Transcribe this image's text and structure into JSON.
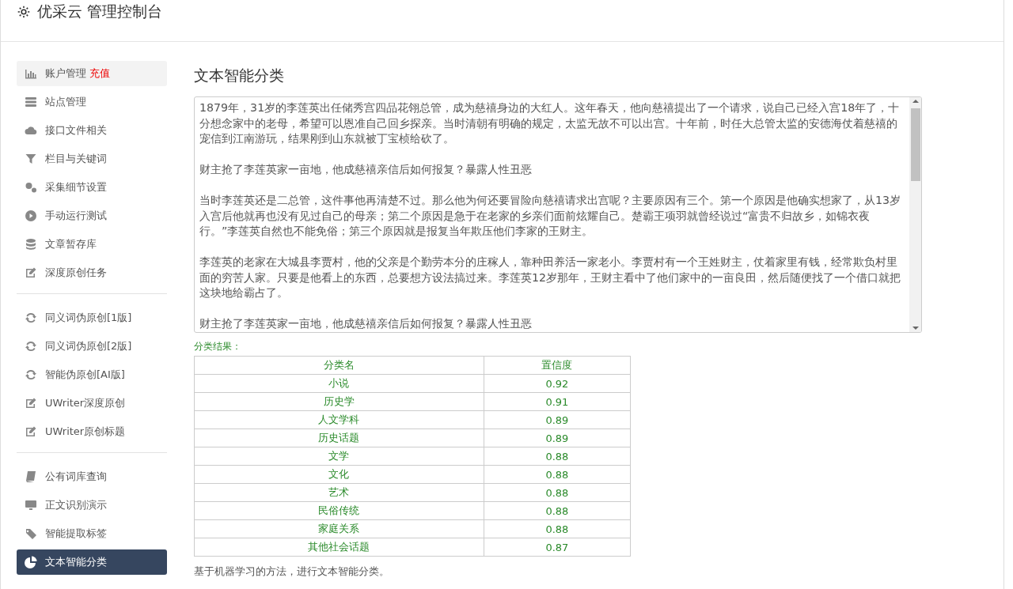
{
  "header": {
    "title": "优采云 管理控制台"
  },
  "sidebar": {
    "groups": [
      {
        "items": [
          {
            "label": "账户管理",
            "badge": "充值",
            "highlighted": true,
            "selected": false
          },
          {
            "label": "站点管理",
            "highlighted": false,
            "selected": false
          },
          {
            "label": "接口文件相关",
            "highlighted": false,
            "selected": false
          },
          {
            "label": "栏目与关键词",
            "highlighted": false,
            "selected": false
          },
          {
            "label": "采集细节设置",
            "highlighted": false,
            "selected": false
          },
          {
            "label": "手动运行测试",
            "highlighted": false,
            "selected": false
          },
          {
            "label": "文章暂存库",
            "highlighted": false,
            "selected": false
          },
          {
            "label": "深度原创任务",
            "highlighted": false,
            "selected": false
          }
        ]
      },
      {
        "items": [
          {
            "label": "同义词伪原创[1版]",
            "highlighted": false,
            "selected": false
          },
          {
            "label": "同义词伪原创[2版]",
            "highlighted": false,
            "selected": false
          },
          {
            "label": "智能伪原创[AI版]",
            "highlighted": false,
            "selected": false
          },
          {
            "label": "UWriter深度原创",
            "highlighted": false,
            "selected": false
          },
          {
            "label": "UWriter原创标题",
            "highlighted": false,
            "selected": false
          }
        ]
      },
      {
        "items": [
          {
            "label": "公有词库查询",
            "highlighted": false,
            "selected": false
          },
          {
            "label": "正文识别演示",
            "highlighted": false,
            "selected": false
          },
          {
            "label": "智能提取标签",
            "highlighted": false,
            "selected": false
          },
          {
            "label": "文本智能分类",
            "highlighted": false,
            "selected": true
          }
        ]
      }
    ]
  },
  "main": {
    "title": "文本智能分类",
    "text_input": {
      "paragraphs": [
        "1879年，31岁的李莲英出任储秀宫四品花翎总管，成为慈禧身边的大红人。这年春天，他向慈禧提出了一个请求，说自己已经入宫18年了，十分想念家中的老母，希望可以恩准自己回乡探亲。当时清朝有明确的规定，太监无故不可以出宫。十年前，时任大总管太监的安德海仗着慈禧的宠信到江南游玩，结果刚到山东就被丁宝桢给砍了。",
        "财主抢了李莲英家一亩地，他成慈禧亲信后如何报复？暴露人性丑恶",
        "当时李莲英还是二总管，这件事他再清楚不过。那么他为何还要冒险向慈禧请求出宫呢？主要原因有三个。第一个原因是他确实想家了，从13岁入宫后他就再也没有见过自己的母亲；第二个原因是急于在老家的乡亲们面前炫耀自己。楚霸王项羽就曾经说过“富贵不归故乡，如锦衣夜行。”李莲英自然也不能免俗；第三个原因就是报复当年欺压他们李家的王财主。",
        "李莲英的老家在大城县李贾村，他的父亲是个勤劳本分的庄稼人，靠种田养活一家老小。李贾村有一个王姓财主，仗着家里有钱，经常欺负村里面的穷苦人家。只要是他看上的东西，总要想方设法搞过来。李莲英12岁那年，王财主看中了他们家中的一亩良田，然后随便找了一个借口就把这块地给霸占了。",
        "财主抢了李莲英家一亩地，他成慈禧亲信后如何报复？暴露人性丑恶"
      ]
    },
    "result_label": "分类结果：",
    "table": {
      "columns": [
        "分类名",
        "置信度"
      ],
      "rows": [
        [
          "小说",
          "0.92"
        ],
        [
          "历史学",
          "0.91"
        ],
        [
          "人文学科",
          "0.89"
        ],
        [
          "历史话题",
          "0.89"
        ],
        [
          "文学",
          "0.88"
        ],
        [
          "文化",
          "0.88"
        ],
        [
          "艺术",
          "0.88"
        ],
        [
          "民俗传统",
          "0.88"
        ],
        [
          "家庭关系",
          "0.88"
        ],
        [
          "其他社会话题",
          "0.87"
        ]
      ]
    },
    "footnote": "基于机器学习的方法，进行文本智能分类。"
  }
}
